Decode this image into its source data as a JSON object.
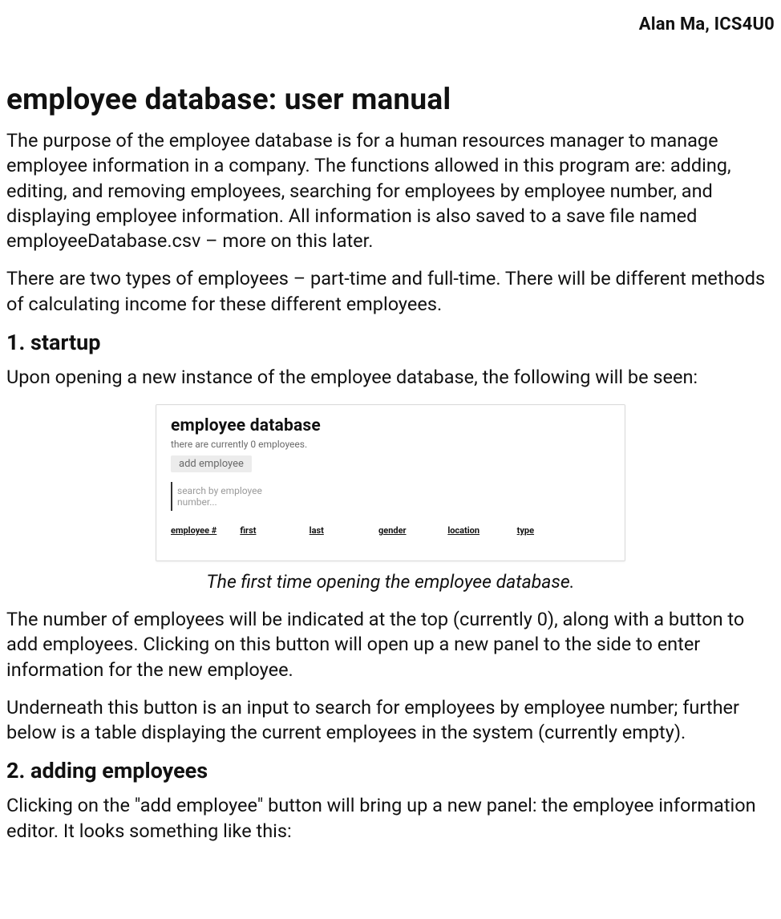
{
  "header": {
    "author_course": "Alan Ma, ICS4U0"
  },
  "doc": {
    "title": "employee database: user manual",
    "intro_p1": "The purpose of the employee database is for a human resources manager to manage employee information in a company. The functions allowed in this program are: adding, editing, and removing employees, searching for employees by employee number, and displaying employee information. All information is also saved to a save file named employeeDatabase.csv – more on this later.",
    "intro_p2": "There are two types of employees – part-time and full-time. There will be different methods of calculating income for these different employees.",
    "section1_heading": "1. startup",
    "section1_p1": "Upon opening a new instance of the employee database, the following will be seen:",
    "figure1_caption": "The first time opening the employee database.",
    "section1_p2": "The number of employees will be indicated at the top (currently 0), along with a button to add employees. Clicking on this button will open up a new panel to the side to enter information for the new employee.",
    "section1_p3": "Underneath this button is an input to search for employees by employee number; further below is a table displaying the current employees in the system (currently empty).",
    "section2_heading": "2. adding employees",
    "section2_p1": "Clicking on the \"add employee\" button will bring up a new panel: the employee information editor. It looks something like this:"
  },
  "app": {
    "title": "employee database",
    "status": "there are currently 0 employees.",
    "add_button": "add employee",
    "search_placeholder": "search by employee number...",
    "columns": {
      "c1": "employee #",
      "c2": "first",
      "c3": "last",
      "c4": "gender",
      "c5": "location",
      "c6": "type"
    }
  }
}
